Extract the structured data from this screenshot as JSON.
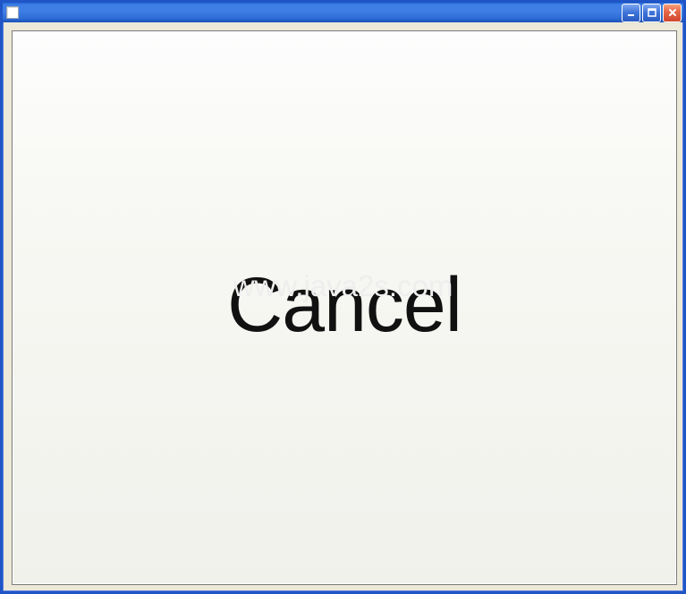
{
  "window": {
    "title": ""
  },
  "titlebar": {
    "minimize_tooltip": "Minimize",
    "maximize_tooltip": "Maximize",
    "close_tooltip": "Close"
  },
  "content": {
    "button_label": "Cancel"
  },
  "watermark": {
    "text": "www.java2s.com"
  }
}
